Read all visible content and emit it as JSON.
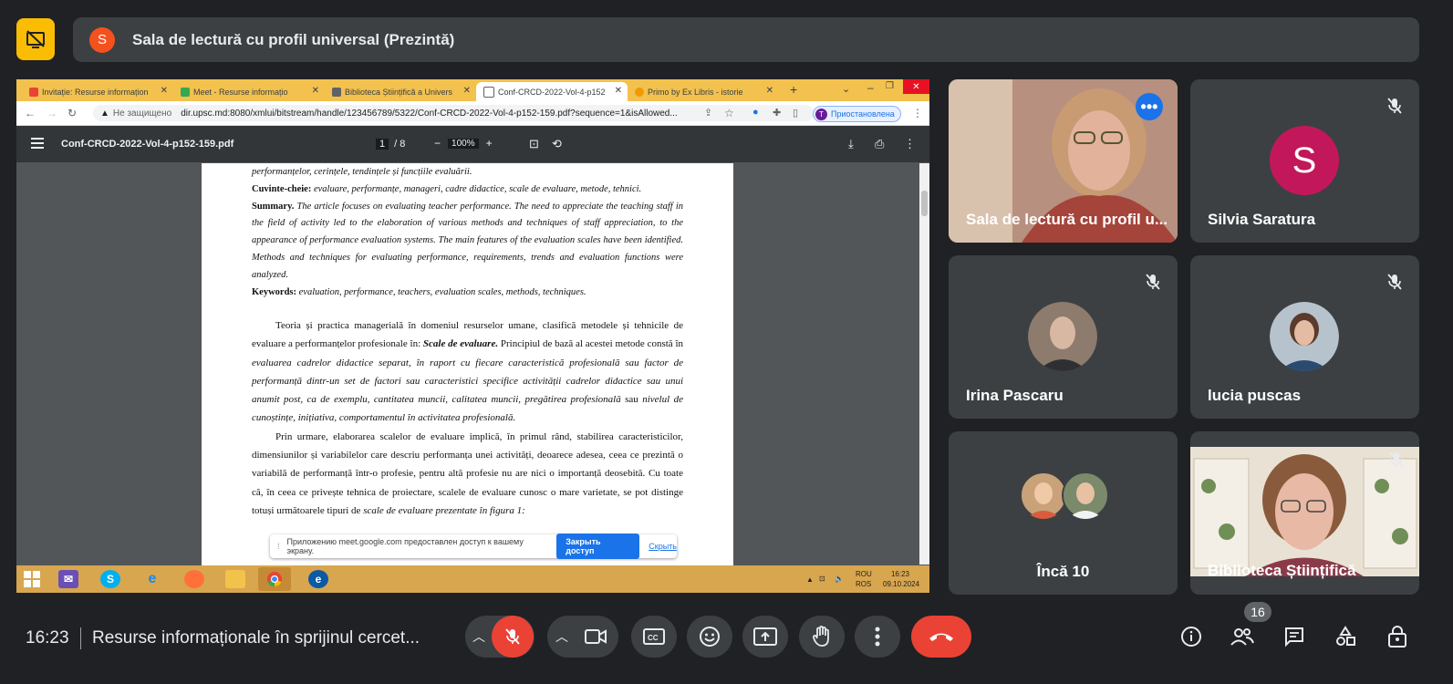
{
  "top": {
    "presenter_initial": "S",
    "presenter_title": "Sala de lectură cu profil universal (Prezintă)"
  },
  "browser": {
    "tabs": [
      {
        "label": "Invitație: Resurse informațion",
        "color": "#ea4335"
      },
      {
        "label": "Meet - Resurse informațio",
        "color": "#34a853"
      },
      {
        "label": "Biblioteca Științifică a Univers",
        "color": "#5f6368"
      },
      {
        "label": "Conf-CRCD-2022-Vol-4-p152",
        "color": "#5f6368"
      },
      {
        "label": "Primo by Ex Libris - istorie",
        "color": "#f29900"
      }
    ],
    "not_secure": "Не защищено",
    "url": "dir.upsc.md:8080/xmlui/bitstream/handle/123456789/5322/Conf-CRCD-2022-Vol-4-p152-159.pdf?sequence=1&isAllowed...",
    "profile_initial": "T",
    "profile_status": "Приостановлена"
  },
  "pdf": {
    "filename": "Conf-CRCD-2022-Vol-4-p152-159.pdf",
    "page_current": "1",
    "page_total": "/ 8",
    "zoom": "100%",
    "lines": {
      "l0": "performanțelor, cerințele, tendințele și funcțiile evaluării.",
      "kw_ro_label": "Cuvinte-cheie:",
      "kw_ro": " evaluare, performanțe, manageri, cadre didactice, scale de evaluare, metode, tehnici.",
      "sum_label": "Summary.",
      "sum_text": " The article focuses on evaluating teacher performance. The need to appreciate the teaching staff in the field of activity led to the elaboration of various methods and techniques of staff appreciation, to the appearance of performance evaluation systems. The main features of the evaluation scales have been identified. Methods and techniques for evaluating performance, requirements, trends and evaluation functions were analyzed.",
      "kw_en_label": "Keywords:",
      "kw_en": " evaluation, performance, teachers, evaluation scales, methods, techniques.",
      "p1_a": "Teoria și practica managerială în domeniul resurselor umane, clasifică metodele și tehnicile de evaluare a performanțelor profesionale în: ",
      "p1_b": "Scale de evaluare.",
      "p1_c": " Principiul de bază al acestei metode constă în ",
      "p1_d": "evaluarea cadrelor didactice separat, în raport cu fiecare caracteristică profesională sau factor de performanță dintr-un set de factori sau caracteristici specifice activității cadrelor didactice sau unui anumit post, ca de exemplu, cantitatea muncii, calitatea muncii, pregătirea profesională",
      "p1_e": " sau ",
      "p1_f": "nivelul de cunoștințe, inițiativa, comportamentul în activitatea profesională.",
      "p2_a": "Prin urmare, elaborarea scalelor de evaluare implică, în primul rând, stabilirea caracteristicilor, dimensiunilor și variabilelor care descriu performanța unei activități, deoarece adesea, ceea ce prezintă o variabilă de performanță într-o profesie, pentru altă profesie nu are nici o importanță deosebită. Cu toate că, în ceea ce privește tehnica de proiectare, scalele de evaluare cunosc o mare varietate, se pot distinge totuși următoarele tipuri de ",
      "p2_b": "scale de evaluare prezentate în figura 1:"
    }
  },
  "notice": {
    "message": "Приложению meet.google.com предоставлен доступ к вашему экрану.",
    "stop_button": "Закрыть доступ",
    "hide_link": "Скрыть"
  },
  "taskbar": {
    "lang1": "ROU",
    "lang2": "ROS",
    "time": "16:23",
    "date": "09.10.2024"
  },
  "tiles": [
    {
      "name": "Sala de lectură cu profil u...",
      "type": "video"
    },
    {
      "name": "Silvia Saratura",
      "initial": "S",
      "avatar_color": "#c2185b",
      "muted": true
    },
    {
      "name": "Irina Pascaru",
      "muted": true
    },
    {
      "name": "lucia puscas",
      "muted": true
    },
    {
      "name": "Încă 10"
    },
    {
      "name": "Biblioteca Științifică",
      "muted": true
    }
  ],
  "bottom": {
    "time": "16:23",
    "meeting_title": "Resurse informaționale în sprijinul cercet...",
    "participants_count": "16"
  }
}
